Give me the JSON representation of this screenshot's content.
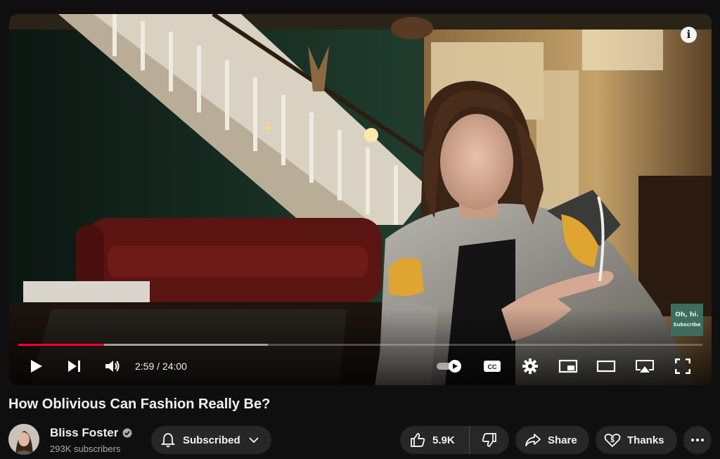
{
  "player": {
    "current_time": "2:59",
    "separator": " / ",
    "duration": "24:00",
    "played_fraction": 0.125,
    "buffered_fraction": 0.365,
    "watermark_line1": "Oh, hi.",
    "watermark_line2": "Subscribe",
    "info_label": "i",
    "cc_label": "CC",
    "progress_color": "#ff0033",
    "autoplay_on": true
  },
  "video": {
    "title": "How Oblivious Can Fashion Really Be?"
  },
  "channel": {
    "name": "Bliss Foster",
    "verified": true,
    "subscribers": "293K subscribers"
  },
  "actions": {
    "subscribe_label": "Subscribed",
    "like_count": "5.9K",
    "share_label": "Share",
    "thanks_label": "Thanks"
  },
  "icons": [
    "play-icon",
    "next-icon",
    "volume-icon",
    "autoplay-toggle-icon",
    "captions-icon",
    "settings-gear-icon",
    "miniplayer-icon",
    "theater-mode-icon",
    "cast-icon",
    "fullscreen-icon",
    "bell-icon",
    "chevron-down-icon",
    "thumbs-up-icon",
    "thumbs-down-icon",
    "share-arrow-icon",
    "thanks-heart-dollar-icon",
    "more-dots-icon",
    "verified-check-icon"
  ]
}
